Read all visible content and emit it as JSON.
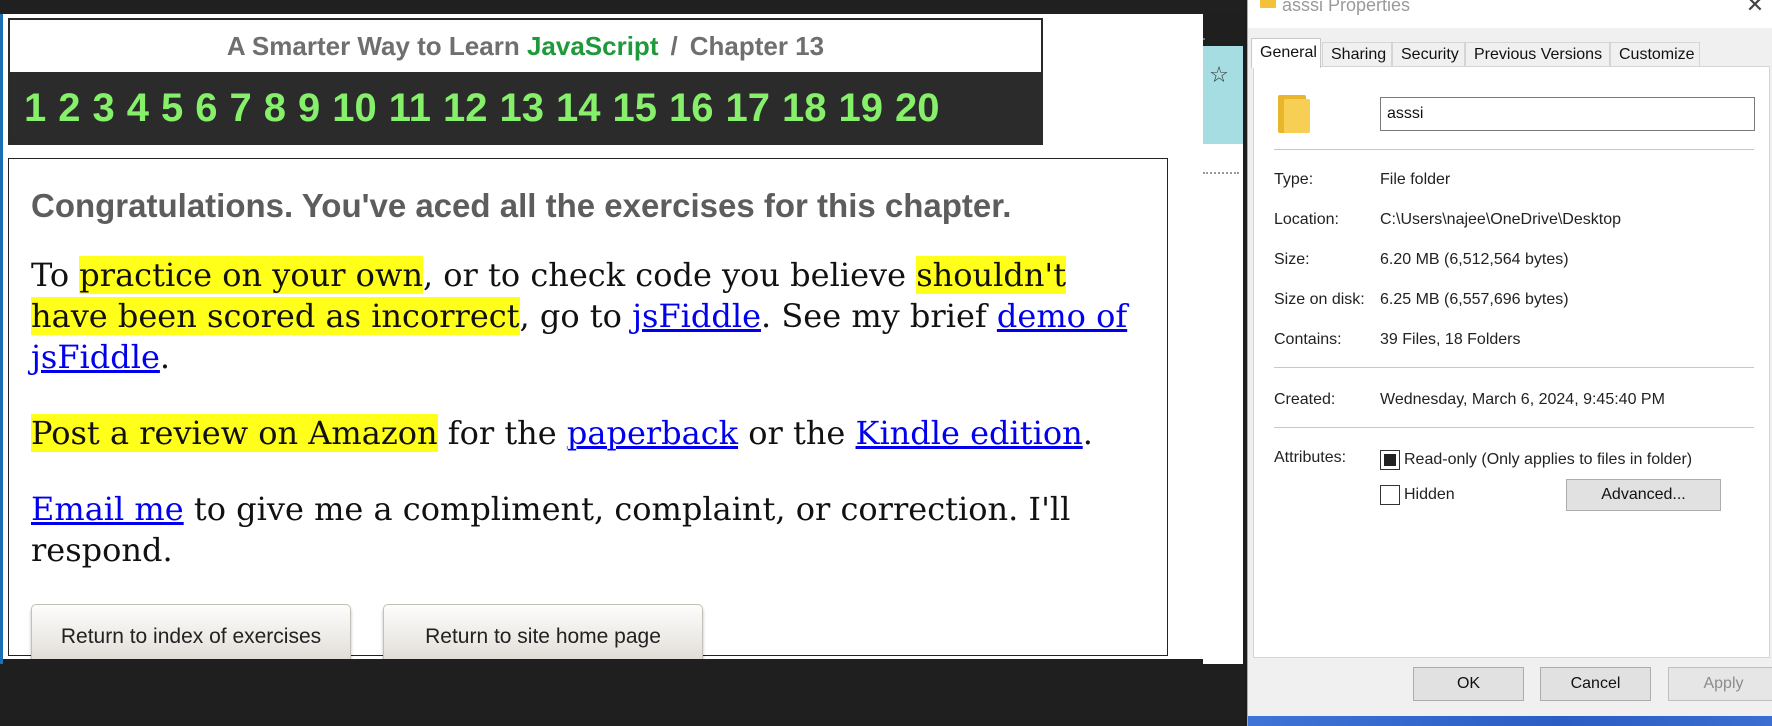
{
  "browser": {
    "header": {
      "title_prefix": "A Smarter Way to Learn",
      "title_brand": "JavaScript",
      "title_separator": "/",
      "chapter_label": "Chapter 13"
    },
    "chapter_nav": [
      "1",
      "2",
      "3",
      "4",
      "5",
      "6",
      "7",
      "8",
      "9",
      "10",
      "11",
      "12",
      "13",
      "14",
      "15",
      "16",
      "17",
      "18",
      "19",
      "20"
    ],
    "content": {
      "congrats": "Congratulations. You've aced all the exercises for this chapter.",
      "para1": {
        "t1": "To ",
        "h1": "practice on your own",
        "t2": ", or to check code you believe ",
        "h2": "shouldn't have been scored as incorrect",
        "t3": ", go to ",
        "link1": "jsFiddle",
        "t4": ". See my brief ",
        "link2": "demo of jsFiddle",
        "t5": "."
      },
      "para2": {
        "h1": "Post a review on Amazon",
        "t1": " for the ",
        "link1": "paperback",
        "t2": " or the ",
        "link2": "Kindle edition",
        "t3": "."
      },
      "para3": {
        "link1": "Email me",
        "t1": " to give me a compliment, complaint, or correction. I'll respond."
      },
      "buttons": {
        "index": "Return to index of exercises",
        "home": "Return to site home page"
      }
    },
    "bookmark_icon": "star-icon"
  },
  "dialog": {
    "title": "asssi Properties",
    "close_glyph": "✕",
    "tabs": [
      "General",
      "Sharing",
      "Security",
      "Previous Versions",
      "Customize"
    ],
    "active_tab": "General",
    "folder_name": "asssi",
    "properties": {
      "type_label": "Type:",
      "type_value": "File folder",
      "location_label": "Location:",
      "location_value": "C:\\Users\\najee\\OneDrive\\Desktop",
      "size_label": "Size:",
      "size_value": "6.20 MB (6,512,564 bytes)",
      "size_on_disk_label": "Size on disk:",
      "size_on_disk_value": "6.25 MB (6,557,696 bytes)",
      "contains_label": "Contains:",
      "contains_value": "39 Files, 18 Folders",
      "created_label": "Created:",
      "created_value": "Wednesday, March 6, 2024, 9:45:40 PM",
      "attributes_label": "Attributes:"
    },
    "attributes": {
      "readonly_label": "Read-only (Only applies to files in folder)",
      "readonly_state": "indeterminate",
      "hidden_label": "Hidden",
      "hidden_state": "unchecked",
      "advanced_label": "Advanced..."
    },
    "buttons": {
      "ok": "OK",
      "cancel": "Cancel",
      "apply": "Apply"
    }
  },
  "colors": {
    "brand_green": "#1f9a3a",
    "chapter_number_green": "#86f06a",
    "highlight_yellow": "#ffff1a",
    "link_blue": "#0000ee"
  }
}
